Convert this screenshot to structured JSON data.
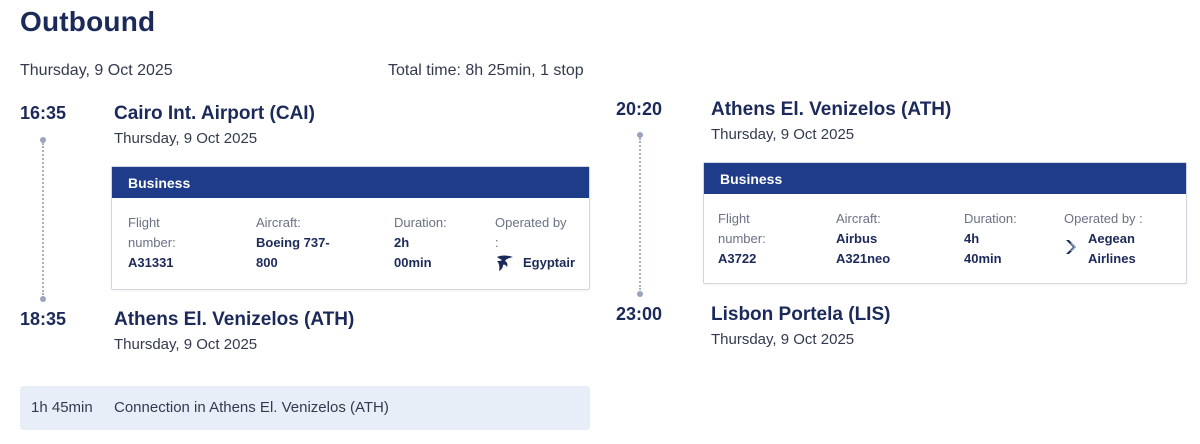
{
  "title": "Outbound",
  "date": "Thursday, 9 Oct 2025",
  "total_time": "Total time: 8h 25min, 1 stop",
  "legs": [
    {
      "depart_time": "16:35",
      "depart_place": "Cairo Int. Airport (CAI)",
      "depart_date": "Thursday, 9 Oct 2025",
      "arrive_time": "18:35",
      "arrive_place": "Athens El. Venizelos (ATH)",
      "arrive_date": "Thursday, 9 Oct 2025",
      "cabin": "Business",
      "flight_label_1": "Flight",
      "flight_label_2": "number:",
      "flight_number": "A31331",
      "aircraft_label": "Aircraft:",
      "aircraft_1": "Boeing 737-",
      "aircraft_2": "800",
      "duration_label": "Duration:",
      "duration_1": "2h",
      "duration_2": "00min",
      "operated_label_1": "Operated by",
      "operated_label_2": ":",
      "operator": "Egyptair",
      "operator_icon": "egyptair-logo-icon"
    },
    {
      "depart_time": "20:20",
      "depart_place": "Athens El. Venizelos (ATH)",
      "depart_date": "Thursday, 9 Oct 2025",
      "arrive_time": "23:00",
      "arrive_place": "Lisbon Portela (LIS)",
      "arrive_date": "Thursday, 9 Oct 2025",
      "cabin": "Business",
      "flight_label_1": "Flight",
      "flight_label_2": "number:",
      "flight_number": "A3722",
      "aircraft_label": "Aircraft:",
      "aircraft_1": "Airbus",
      "aircraft_2": "A321neo",
      "duration_label": "Duration:",
      "duration_1": "4h",
      "duration_2": "40min",
      "operated_label_1": "Operated by :",
      "operator_1": "Aegean",
      "operator_2": "Airlines",
      "operator_icon": "aegean-logo-icon"
    }
  ],
  "connection": {
    "duration": "1h 45min",
    "text": "Connection in Athens El. Venizelos (ATH)"
  },
  "colors": {
    "primary": "#1e3c8a",
    "text_dark": "#1c2a5a",
    "connection_bg": "#e8eef8"
  }
}
